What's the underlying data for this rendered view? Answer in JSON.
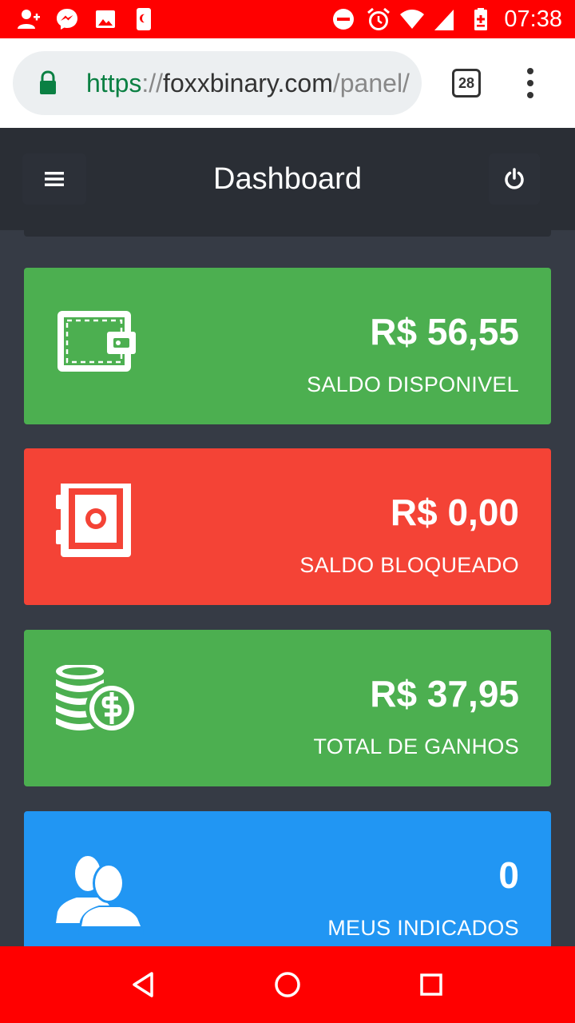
{
  "status_bar": {
    "time": "07:38",
    "left_icons": [
      "person-add-icon",
      "messenger-icon",
      "image-icon",
      "app-icon"
    ],
    "right_icons": [
      "do-not-disturb-icon",
      "alarm-icon",
      "wifi-icon",
      "signal-icon",
      "battery-charging-icon"
    ],
    "color": "#ff0000"
  },
  "browser": {
    "url_scheme": "https",
    "url_separator": "://",
    "url_host": "foxxbinary.com",
    "url_path": "/panel/",
    "tab_count": "28"
  },
  "header": {
    "title": "Dashboard"
  },
  "cards": [
    {
      "value": "R$ 56,55",
      "label": "SALDO DISPONIVEL",
      "icon": "wallet-icon",
      "color": "#4caf50"
    },
    {
      "value": "R$ 0,00",
      "label": "SALDO BLOQUEADO",
      "icon": "safe-icon",
      "color": "#f44336"
    },
    {
      "value": "R$ 37,95",
      "label": "TOTAL DE GANHOS",
      "icon": "coins-dollar-icon",
      "color": "#4caf50"
    },
    {
      "value": "0",
      "label": "MEUS INDICADOS",
      "icon": "users-icon",
      "color": "#2196f3"
    }
  ],
  "nav_bar": {
    "buttons": [
      "back-icon",
      "home-icon",
      "recents-icon"
    ]
  }
}
